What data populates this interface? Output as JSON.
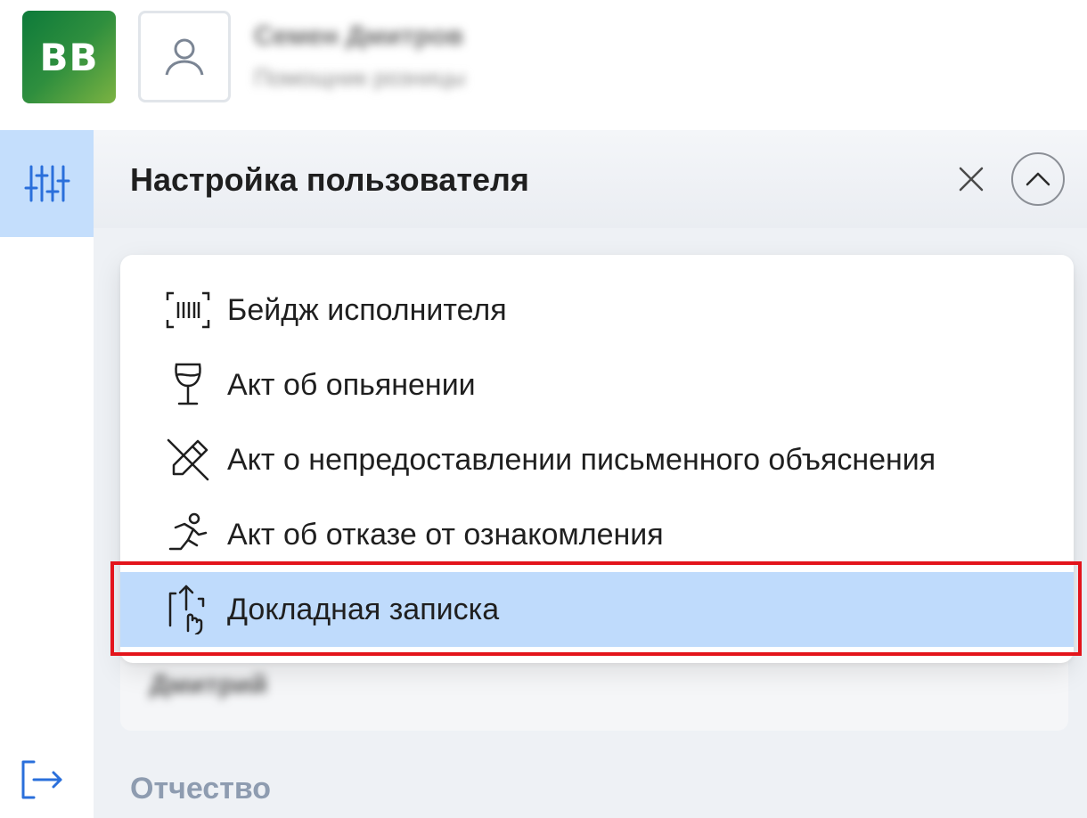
{
  "header": {
    "logo_text": "BB",
    "user_name": "Семен Дмитров",
    "user_role": "Помощник розницы",
    "avatar_icon": "user-icon"
  },
  "rail": {
    "active_icon": "sliders-icon",
    "logout_icon": "logout-icon"
  },
  "panel": {
    "title": "Настройка пользователя",
    "close_icon": "close-icon",
    "collapse_icon": "chevron-up-icon",
    "under_field_value": "Дмитрий",
    "section_label": "Отчество"
  },
  "menu": {
    "items": [
      {
        "label": "Бейдж исполнителя",
        "icon": "badge-barcode-icon"
      },
      {
        "label": "Акт об опьянении",
        "icon": "wine-glass-icon"
      },
      {
        "label": "Акт о непредоставлении письменного объяснения",
        "icon": "pencil-crossed-icon"
      },
      {
        "label": "Акт об отказе от ознакомления",
        "icon": "running-person-icon"
      },
      {
        "label": "Докладная записка",
        "icon": "hand-upload-icon"
      }
    ],
    "selected_index": 4
  },
  "colors": {
    "accent": "#2a6fdb",
    "selected_bg": "#bfdbfc",
    "highlight_border": "#e3141b",
    "logo_green": "#2f8f3e"
  }
}
